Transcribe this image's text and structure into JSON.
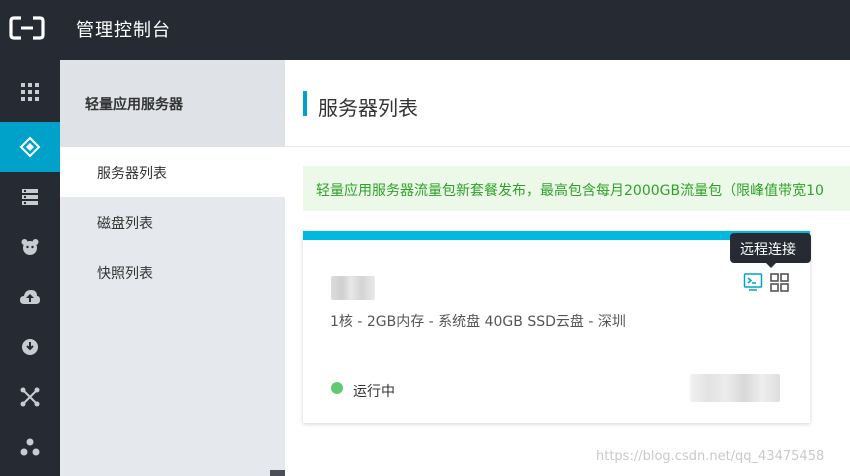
{
  "topbar": {
    "logo_icon": "aliyun-logo-icon",
    "title": "管理控制台"
  },
  "rail": {
    "items": [
      {
        "icon": "grid-apps-icon",
        "active": false
      },
      {
        "icon": "light-server-icon",
        "active": true
      },
      {
        "icon": "server-list-icon",
        "active": false
      },
      {
        "icon": "bear-paw-icon",
        "active": false
      },
      {
        "icon": "cloud-upload-icon",
        "active": false
      },
      {
        "icon": "cloud-download-icon",
        "active": false
      },
      {
        "icon": "network-nodes-icon",
        "active": false
      },
      {
        "icon": "cluster-icon",
        "active": false
      }
    ]
  },
  "subnav": {
    "title": "轻量应用服务器",
    "items": [
      {
        "label": "服务器列表",
        "active": true
      },
      {
        "label": "磁盘列表",
        "active": false
      },
      {
        "label": "快照列表",
        "active": false
      }
    ]
  },
  "main": {
    "page_title": "服务器列表",
    "notice": "轻量应用服务器流量包新套餐发布，最高包含每月2000GB流量包（限峰值带宽10",
    "card": {
      "specs": "1核 - 2GB内存 - 系统盘 40GB SSD云盘 - 深圳",
      "status": "运行中",
      "tooltip": "远程连接",
      "actions": [
        "terminal-icon",
        "app-grid-icon"
      ]
    }
  },
  "watermark": "https://blog.csdn.net/qq_43475458",
  "colors": {
    "topbar": "#262b33",
    "accent": "#00a2c9",
    "card_top": "#00b9e0",
    "notice_bg": "#edf9e8",
    "notice_text": "#2fa12b",
    "status_running": "#62c973"
  }
}
